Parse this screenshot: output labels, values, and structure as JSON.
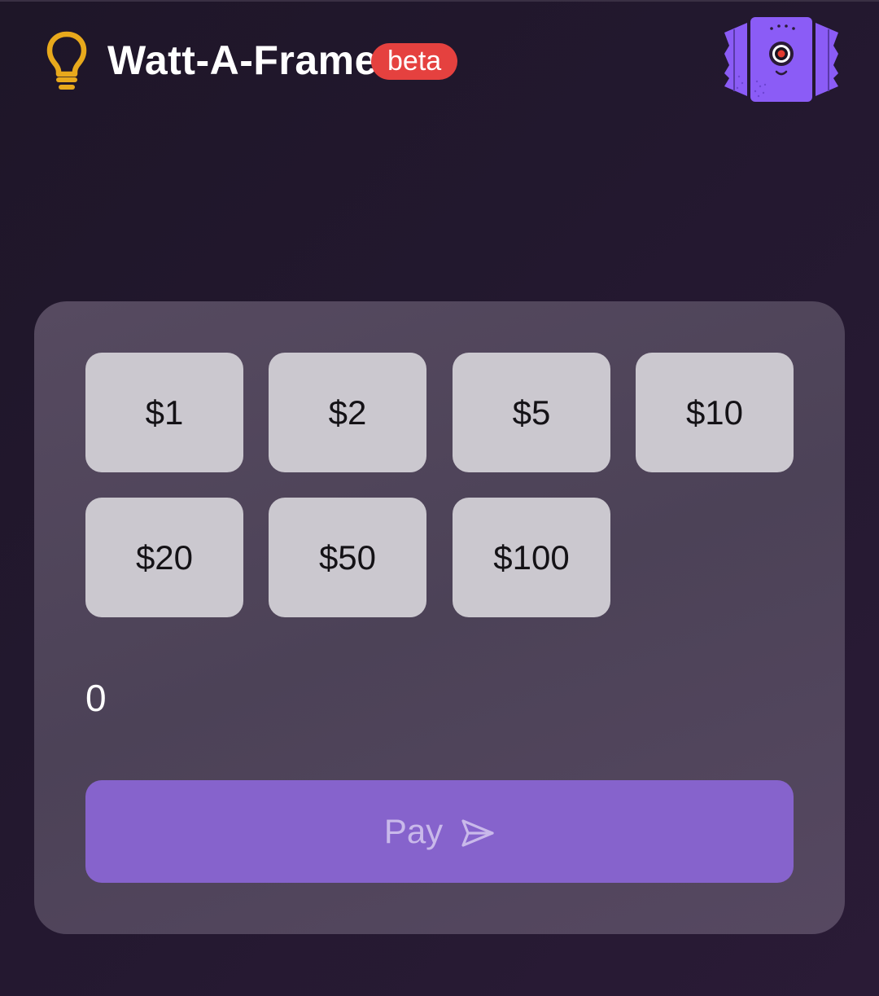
{
  "header": {
    "icon": "lightbulb-icon",
    "title": "Watt-A-Frame",
    "badge": "beta",
    "avatar_icon": "robot-frame-icon"
  },
  "amounts": [
    "$1",
    "$2",
    "$5",
    "$10",
    "$20",
    "$50",
    "$100"
  ],
  "amount_value": "0",
  "pay": {
    "label": "Pay",
    "icon": "send-icon"
  },
  "colors": {
    "background": "#221830",
    "card": "#514659",
    "amount_button": "#cbc8cf",
    "pay_button": "#8663cc",
    "pay_text": "#c9b9ea",
    "badge": "#e5413f",
    "bulb": "#e8a91c",
    "robot": "#8b5cf6"
  }
}
